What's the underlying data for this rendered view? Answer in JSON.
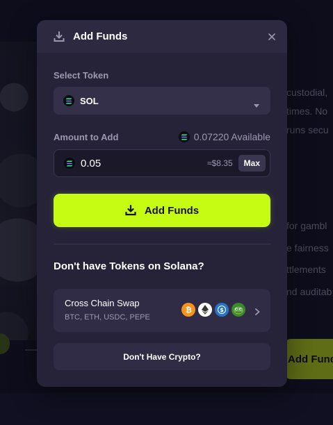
{
  "modal": {
    "title": "Add Funds",
    "select_token_label": "Select Token",
    "selected_token": "SOL",
    "amount_label": "Amount to Add",
    "available": "0.07220 Available",
    "amount_value": "0.05",
    "usd_estimate": "≈$8.35",
    "max_label": "Max",
    "add_button_label": "Add Funds",
    "no_tokens_question": "Don't have Tokens on Solana?",
    "cross_chain": {
      "title": "Cross Chain Swap",
      "subtitle": "BTC, ETH, USDC, PEPE",
      "coins": [
        "btc-icon",
        "eth-icon",
        "usdc-icon",
        "pepe-icon"
      ]
    },
    "no_crypto_label": "Don't Have Crypto?"
  },
  "background": {
    "text_lines_top": [
      "custodial,",
      "times. No",
      "runs secu"
    ],
    "text_lines_bottom": [
      "for gambl",
      "e fairness",
      "ttlements",
      "nd auditab"
    ],
    "button_label": "Add Fund"
  },
  "colors": {
    "accent": "#c6fb14",
    "modal_bg": "#262339",
    "card_bg": "#302c46",
    "muted_text": "#9b98b0"
  }
}
